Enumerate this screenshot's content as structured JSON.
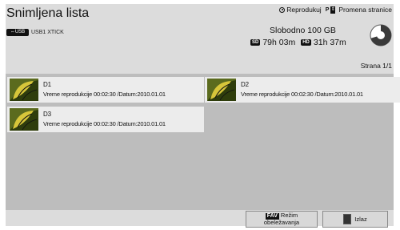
{
  "header": {
    "title": "Snimljena lista",
    "device_badge": "USB",
    "device_label": "USB1 XTICK",
    "play_label": "Reprodukuj",
    "page_change_label": "Promena stranice",
    "free_label": "Slobodno 100 GB",
    "sd_badge": "SD",
    "sd_time": "79h 03m",
    "hd_badge": "HD",
    "hd_time": "31h 37m",
    "page_label": "Strana 1/1"
  },
  "recordings": [
    {
      "name": "D1",
      "info": "Vreme reprodukcije 00:02:30 /Datum:2010.01.01"
    },
    {
      "name": "D2",
      "info": "Vreme reprodukcije 00:02:30 /Datum:2010.01.01"
    },
    {
      "name": "D3",
      "info": "Vreme reprodukcije 00:02:30 /Datum:2010.01.01"
    }
  ],
  "footer": {
    "fav_badge": "FAV",
    "fav_label_1": "Režim",
    "fav_label_2": "obeležavanja",
    "exit_label": "Izlaz"
  },
  "colors": {
    "panel_bg": "#dcdcdc",
    "list_bg": "#bdbdbd",
    "item_bg": "#ececec"
  }
}
